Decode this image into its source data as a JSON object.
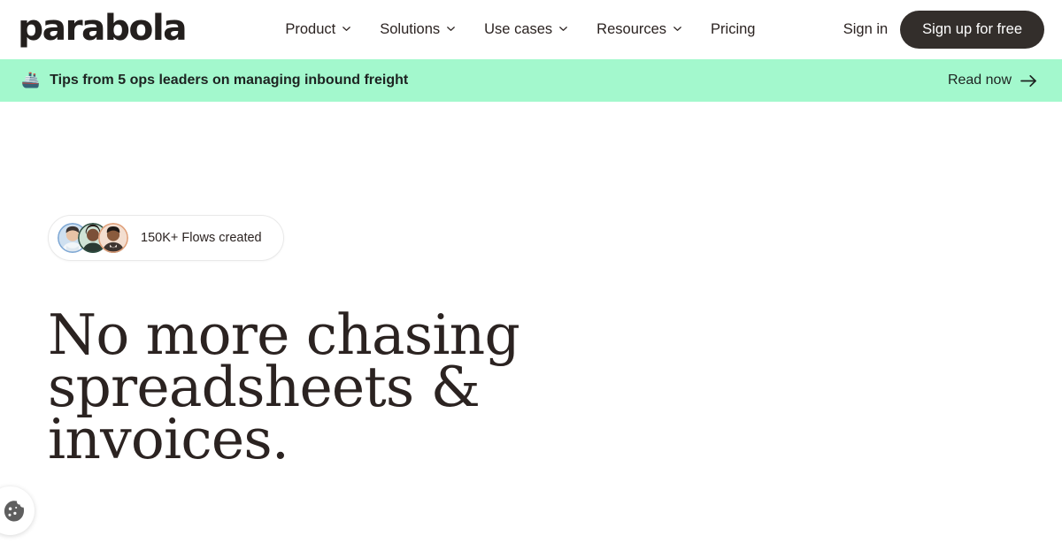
{
  "brand": {
    "logo_text": "parabola",
    "accent_green": "#a3f8cd",
    "dark": "#332e2b",
    "text_dark": "#2b2321"
  },
  "header": {
    "nav": [
      {
        "label": "Product",
        "has_dropdown": true,
        "icon": "chevron-down-icon"
      },
      {
        "label": "Solutions",
        "has_dropdown": true,
        "icon": "chevron-down-icon"
      },
      {
        "label": "Use cases",
        "has_dropdown": true,
        "icon": "chevron-down-icon"
      },
      {
        "label": "Resources",
        "has_dropdown": true,
        "icon": "chevron-down-icon"
      },
      {
        "label": "Pricing",
        "has_dropdown": false,
        "icon": ""
      }
    ],
    "sign_in_label": "Sign in",
    "sign_up_label": "Sign up for free"
  },
  "banner": {
    "emoji": "🚢",
    "emoji_name": "ship-icon",
    "text": "Tips from 5 ops leaders on managing inbound freight",
    "cta_label": "Read now",
    "cta_icon": "arrow-right-icon",
    "background": "#a3f8cd"
  },
  "hero": {
    "social_proof": {
      "text": "150K+ Flows created",
      "avatar_count": 3,
      "avatar_ring_colors": [
        "#7fa8d4",
        "#2f4f43",
        "#e0a07a"
      ]
    },
    "headline": "No more chasing spreadsheets & invoices."
  },
  "cookie_widget": {
    "icon": "cookie-icon",
    "label": "Cookie preferences",
    "color": "#5f5f5f"
  }
}
